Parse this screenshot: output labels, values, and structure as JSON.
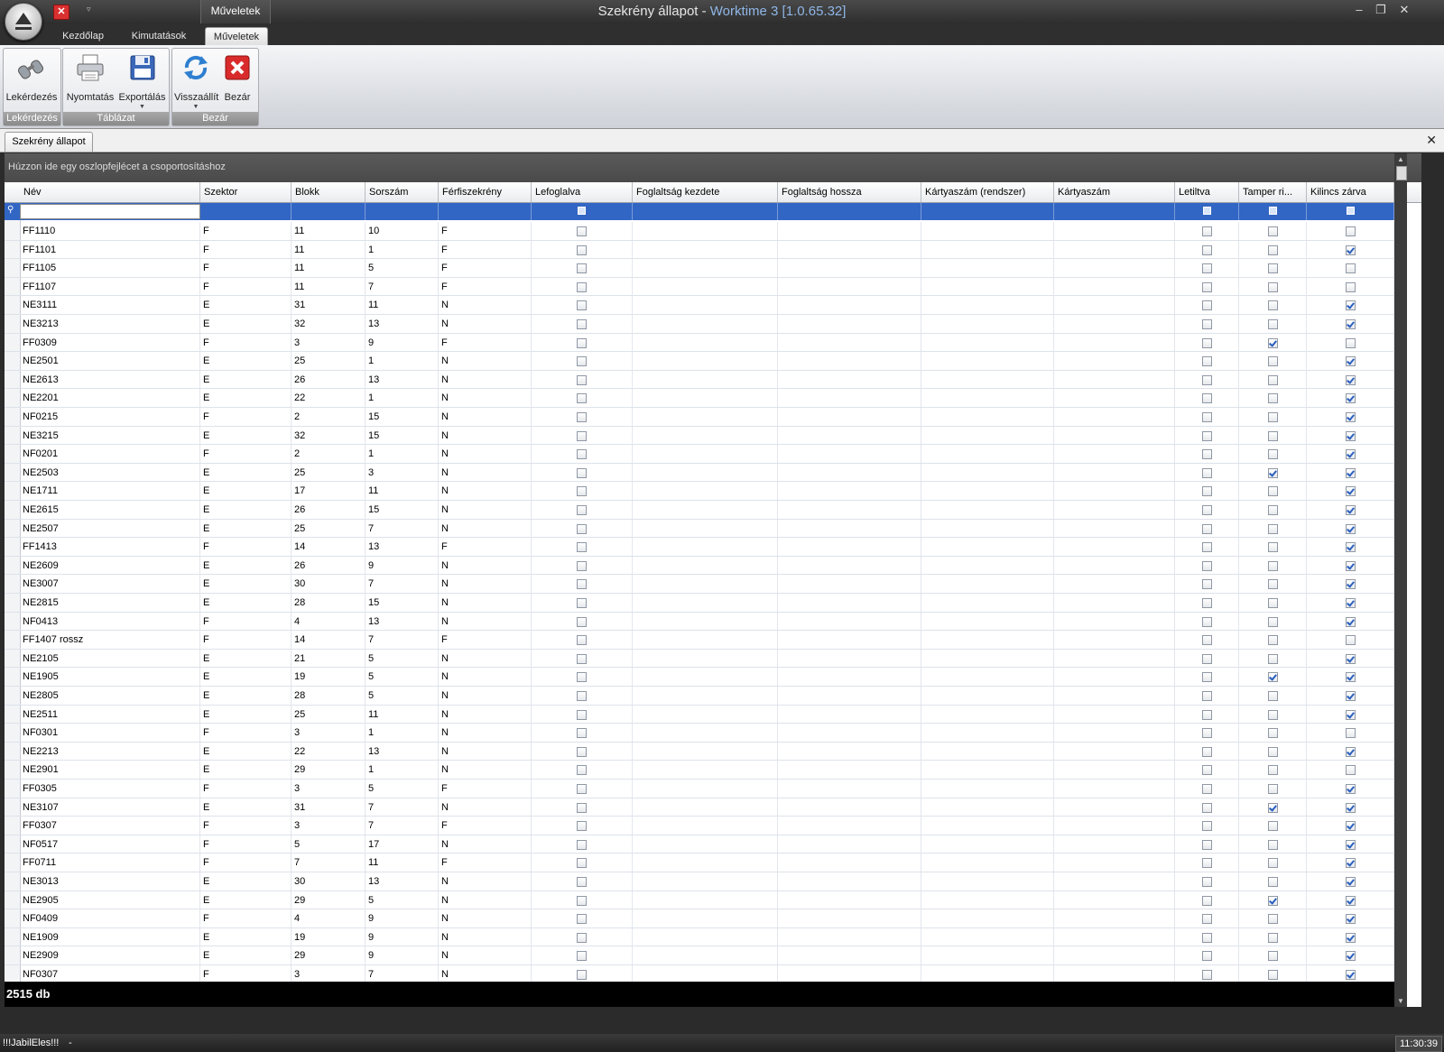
{
  "titlebar": {
    "context_tab": "Műveletek",
    "title": "Szekrény állapot - ",
    "app_version": "Worktime 3 [1.0.65.32]",
    "minimize": "–",
    "restore": "❐",
    "close": "✕",
    "qat_close": "✕",
    "qat_dropdown": "▿"
  },
  "tabs": [
    {
      "label": "Kezdőlap"
    },
    {
      "label": "Kimutatások"
    },
    {
      "label": "Műveletek"
    }
  ],
  "ribbon": {
    "groups": [
      {
        "label": "Lekérdezés",
        "buttons": [
          {
            "label": "Lekérdezés",
            "icon": "binoculars-icon"
          }
        ]
      },
      {
        "label": "Táblázat",
        "buttons": [
          {
            "label": "Nyomtatás",
            "icon": "printer-icon"
          },
          {
            "label": "Exportálás",
            "icon": "floppy-disk-icon"
          }
        ]
      },
      {
        "label": "Bezár",
        "buttons": [
          {
            "label": "Visszaállít",
            "icon": "refresh-icon"
          },
          {
            "label": "Bezár",
            "icon": "close-icon"
          }
        ]
      }
    ]
  },
  "document": {
    "tab_label": "Szekrény állapot",
    "close": "✕"
  },
  "grid": {
    "group_panel_text": "Húzzon ide egy oszlopfejlécet a csoportosításhoz",
    "columns": [
      "Név",
      "Szektor",
      "Blokk",
      "Sorszám",
      "Férfiszekrény",
      "Lefoglalva",
      "Foglaltság kezdete",
      "Foglaltság hossza",
      "Kártyaszám (rendszer)",
      "Kártyaszám",
      "Letiltva",
      "Tamper ri...",
      "Kilincs zárva"
    ],
    "rows": [
      [
        "FF1110",
        "F",
        "11",
        "10",
        "F",
        0,
        0,
        0,
        0
      ],
      [
        "FF1101",
        "F",
        "11",
        "1",
        "F",
        0,
        0,
        0,
        1
      ],
      [
        "FF1105",
        "F",
        "11",
        "5",
        "F",
        0,
        0,
        0,
        0
      ],
      [
        "FF1107",
        "F",
        "11",
        "7",
        "F",
        0,
        0,
        0,
        0
      ],
      [
        "NE3111",
        "E",
        "31",
        "11",
        "N",
        0,
        0,
        0,
        1
      ],
      [
        "NE3213",
        "E",
        "32",
        "13",
        "N",
        0,
        0,
        0,
        1
      ],
      [
        "FF0309",
        "F",
        "3",
        "9",
        "F",
        0,
        0,
        1,
        0
      ],
      [
        "NE2501",
        "E",
        "25",
        "1",
        "N",
        0,
        0,
        0,
        1
      ],
      [
        "NE2613",
        "E",
        "26",
        "13",
        "N",
        0,
        0,
        0,
        1
      ],
      [
        "NE2201",
        "E",
        "22",
        "1",
        "N",
        0,
        0,
        0,
        1
      ],
      [
        "NF0215",
        "F",
        "2",
        "15",
        "N",
        0,
        0,
        0,
        1
      ],
      [
        "NE3215",
        "E",
        "32",
        "15",
        "N",
        0,
        0,
        0,
        1
      ],
      [
        "NF0201",
        "F",
        "2",
        "1",
        "N",
        0,
        0,
        0,
        1
      ],
      [
        "NE2503",
        "E",
        "25",
        "3",
        "N",
        0,
        0,
        1,
        1
      ],
      [
        "NE1711",
        "E",
        "17",
        "11",
        "N",
        0,
        0,
        0,
        1
      ],
      [
        "NE2615",
        "E",
        "26",
        "15",
        "N",
        0,
        0,
        0,
        1
      ],
      [
        "NE2507",
        "E",
        "25",
        "7",
        "N",
        0,
        0,
        0,
        1
      ],
      [
        "FF1413",
        "F",
        "14",
        "13",
        "F",
        0,
        0,
        0,
        1
      ],
      [
        "NE2609",
        "E",
        "26",
        "9",
        "N",
        0,
        0,
        0,
        1
      ],
      [
        "NE3007",
        "E",
        "30",
        "7",
        "N",
        0,
        0,
        0,
        1
      ],
      [
        "NE2815",
        "E",
        "28",
        "15",
        "N",
        0,
        0,
        0,
        1
      ],
      [
        "NF0413",
        "F",
        "4",
        "13",
        "N",
        0,
        0,
        0,
        1
      ],
      [
        "FF1407 rossz",
        "F",
        "14",
        "7",
        "F",
        0,
        0,
        0,
        0
      ],
      [
        "NE2105",
        "E",
        "21",
        "5",
        "N",
        0,
        0,
        0,
        1
      ],
      [
        "NE1905",
        "E",
        "19",
        "5",
        "N",
        0,
        0,
        1,
        1
      ],
      [
        "NE2805",
        "E",
        "28",
        "5",
        "N",
        0,
        0,
        0,
        1
      ],
      [
        "NE2511",
        "E",
        "25",
        "11",
        "N",
        0,
        0,
        0,
        1
      ],
      [
        "NF0301",
        "F",
        "3",
        "1",
        "N",
        0,
        0,
        0,
        0
      ],
      [
        "NE2213",
        "E",
        "22",
        "13",
        "N",
        0,
        0,
        0,
        1
      ],
      [
        "NE2901",
        "E",
        "29",
        "1",
        "N",
        0,
        0,
        0,
        0
      ],
      [
        "FF0305",
        "F",
        "3",
        "5",
        "F",
        0,
        0,
        0,
        1
      ],
      [
        "NE3107",
        "E",
        "31",
        "7",
        "N",
        0,
        0,
        1,
        1
      ],
      [
        "FF0307",
        "F",
        "3",
        "7",
        "F",
        0,
        0,
        0,
        1
      ],
      [
        "NF0517",
        "F",
        "5",
        "17",
        "N",
        0,
        0,
        0,
        1
      ],
      [
        "FF0711",
        "F",
        "7",
        "11",
        "F",
        0,
        0,
        0,
        1
      ],
      [
        "NE3013",
        "E",
        "30",
        "13",
        "N",
        0,
        0,
        0,
        1
      ],
      [
        "NE2905",
        "E",
        "29",
        "5",
        "N",
        0,
        0,
        1,
        1
      ],
      [
        "NF0409",
        "F",
        "4",
        "9",
        "N",
        0,
        0,
        0,
        1
      ],
      [
        "NE1909",
        "E",
        "19",
        "9",
        "N",
        0,
        0,
        0,
        1
      ],
      [
        "NE2909",
        "E",
        "29",
        "9",
        "N",
        0,
        0,
        0,
        1
      ],
      [
        "NF0307",
        "F",
        "3",
        "7",
        "N",
        0,
        0,
        0,
        1
      ]
    ],
    "record_count": "2515 db"
  },
  "taskbar": {
    "item": "!!!JabilEles!!!",
    "separator": "-",
    "clock": "11:30:39"
  }
}
